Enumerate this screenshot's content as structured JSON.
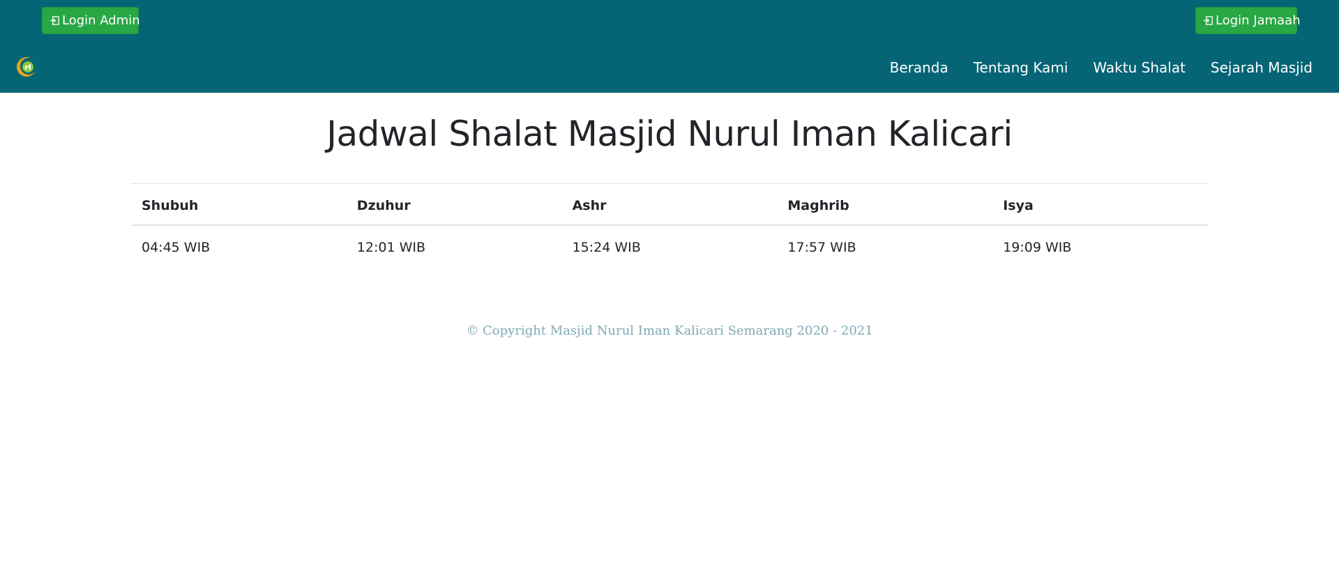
{
  "header": {
    "login_admin": "Login Admin",
    "login_jamaah": "Login Jamaah",
    "colors": {
      "bar": "#066575",
      "button": "#28a745"
    }
  },
  "nav": {
    "items": [
      {
        "label": "Beranda"
      },
      {
        "label": "Tentang Kami"
      },
      {
        "label": "Waktu Shalat"
      },
      {
        "label": "Sejarah Masjid"
      }
    ]
  },
  "main": {
    "title": "Jadwal Shalat Masjid Nurul Iman Kalicari",
    "table": {
      "headers": [
        "Shubuh",
        "Dzuhur",
        "Ashr",
        "Maghrib",
        "Isya"
      ],
      "times": [
        "04:45 WIB",
        "12:01 WIB",
        "15:24 WIB",
        "17:57 WIB",
        "19:09 WIB"
      ]
    }
  },
  "footer": {
    "copyright": "© Copyright Masjid Nurul Iman Kalicari Semarang 2020 - 2021"
  }
}
